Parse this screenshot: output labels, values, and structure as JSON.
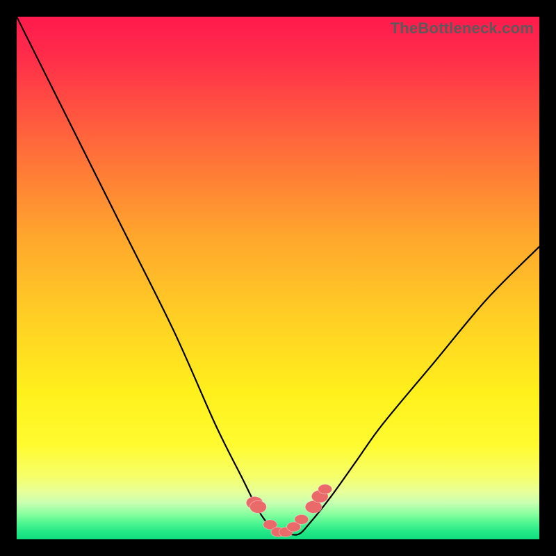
{
  "watermark": "TheBottleneck.com",
  "colors": {
    "frame": "#000000",
    "gradient_top": "#ff1a4d",
    "gradient_bottom": "#10dc80",
    "curve": "#000000",
    "beads": "#ea6a6a"
  },
  "chart_data": {
    "type": "line",
    "title": "",
    "xlabel": "",
    "ylabel": "",
    "xlim": [
      0,
      100
    ],
    "ylim": [
      0,
      100
    ],
    "grid": false,
    "x": [
      0,
      10,
      20,
      30,
      38,
      43,
      46,
      48,
      50,
      52,
      54,
      56,
      60,
      65,
      70,
      80,
      90,
      100
    ],
    "values": [
      100,
      80,
      60,
      40,
      22,
      12,
      6,
      3,
      1,
      1,
      1,
      3,
      8,
      15,
      22,
      34,
      46,
      56
    ],
    "annotations": {
      "beads_x": [
        45.5,
        46.2,
        48.5,
        50.0,
        51.5,
        53.0,
        54.5,
        56.8,
        58.0,
        59.0
      ],
      "beads_y": [
        7.0,
        6.2,
        2.8,
        1.4,
        1.4,
        2.4,
        3.8,
        6.2,
        8.2,
        9.6
      ]
    }
  }
}
